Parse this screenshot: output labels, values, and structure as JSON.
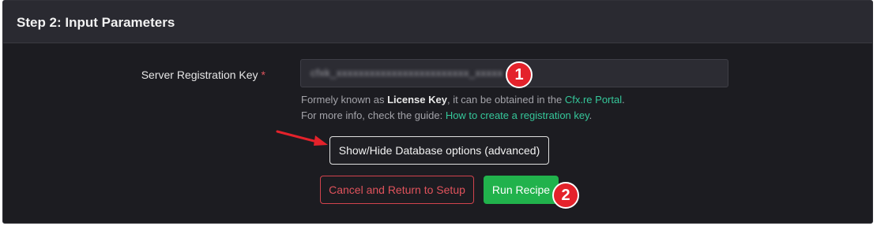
{
  "header": {
    "title": "Step 2: Input Parameters"
  },
  "form": {
    "key_label": "Server Registration Key",
    "required_mark": "*",
    "key_value": "cfxk_xxxxxxxxxxxxxxxxxxxxxxxx_xxxxx",
    "help_line1_prefix": "Formely known as ",
    "help_line1_bold": "License Key",
    "help_line1_middle": ", it can be obtained in the ",
    "help_line1_link": "Cfx.re Portal",
    "help_line1_suffix": ".",
    "help_line2_prefix": "For more info, check the guide: ",
    "help_line2_link": "How to create a registration key",
    "help_line2_suffix": "."
  },
  "buttons": {
    "db_options": "Show/Hide Database options (advanced)",
    "cancel": "Cancel and Return to Setup",
    "run": "Run Recipe"
  },
  "annotations": {
    "badge1": "1",
    "badge2": "2"
  },
  "colors": {
    "card_bg": "#1c1c21",
    "header_bg": "#2a2a31",
    "link": "#35c79a",
    "danger": "#e0535c",
    "success": "#21b24c",
    "annotation_red": "#e4222b"
  }
}
